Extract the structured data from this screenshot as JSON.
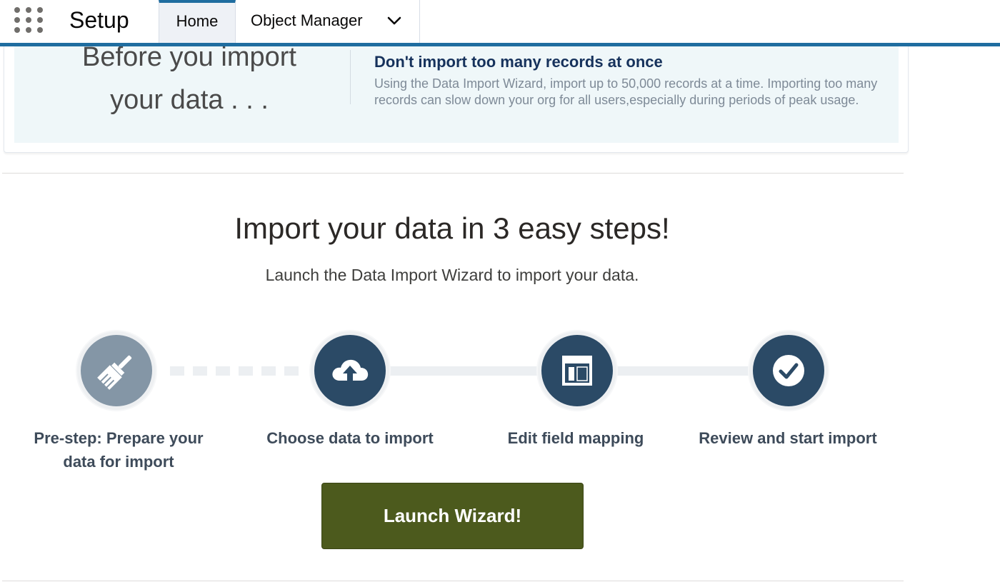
{
  "header": {
    "app_title": "Setup",
    "tabs": [
      {
        "label": "Home"
      },
      {
        "label": "Object Manager"
      }
    ],
    "accent_color": "#1f6da0"
  },
  "info_card": {
    "title": "Before you import\nyour data . . .",
    "tip_title": "Don't import too many records at once",
    "tip_text": "Using the Data Import Wizard, import up to 50,000 records at a time. Importing too many records can slow down your org for all users,especially during periods of peak usage."
  },
  "main": {
    "heading": "Import your data in 3 easy steps!",
    "subheading": "Launch the Data Import Wizard to import your data.",
    "steps": [
      {
        "label": "Pre-step: Prepare your data for import",
        "icon": "broom-icon",
        "color": "#8496a6"
      },
      {
        "label": "Choose data to import",
        "icon": "cloud-upload-icon",
        "color": "#2b4a66"
      },
      {
        "label": "Edit field mapping",
        "icon": "layout-icon",
        "color": "#2b4a66"
      },
      {
        "label": "Review and start import",
        "icon": "check-circle-icon",
        "color": "#2b4a66"
      }
    ],
    "launch_button": "Launch Wizard!",
    "launch_button_color": "#4c5a1d"
  }
}
